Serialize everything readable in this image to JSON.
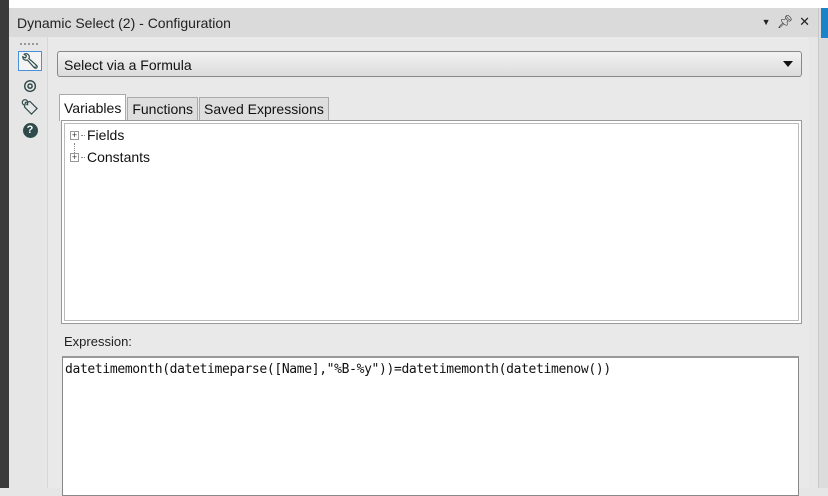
{
  "window": {
    "title": "Dynamic Select (2) - Configuration",
    "controls": [
      "dropdown-icon",
      "pin-icon",
      "close-icon"
    ]
  },
  "sidebar": {
    "icons": [
      "wrench-icon",
      "compass-icon",
      "tag-icon",
      "help-icon"
    ]
  },
  "mode_select": {
    "value": "Select via a Formula"
  },
  "tabs": [
    {
      "label": "Variables"
    },
    {
      "label": "Functions"
    },
    {
      "label": "Saved Expressions"
    }
  ],
  "tree": [
    {
      "label": "Fields"
    },
    {
      "label": "Constants"
    }
  ],
  "expression": {
    "label": "Expression:",
    "value": "datetimemonth(datetimeparse([Name],\"%B-%y\"))=datetimemonth(datetimenow())"
  }
}
